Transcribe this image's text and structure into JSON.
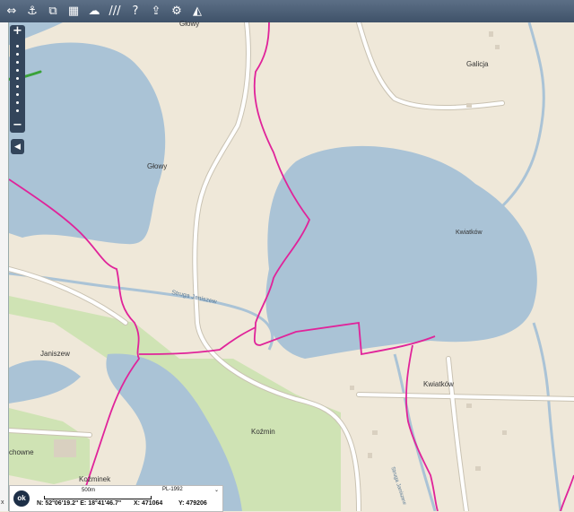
{
  "toolbar": {
    "icons": [
      "pan-icon",
      "anchor-icon",
      "layers-export-icon",
      "layout-icon",
      "bubble-icon",
      "hatch-icon",
      "help-icon",
      "cloud-icon",
      "settings-icon",
      "measure-icon"
    ],
    "glyphs": [
      "⇔",
      "⚓",
      "⧉",
      "▦",
      "☁",
      "///",
      "?",
      "⇪",
      "⚙",
      "◭"
    ]
  },
  "map": {
    "labels": {
      "glowy_top": "Głowy",
      "glowy_lake": "Głowy",
      "galicja": "Galicja",
      "kwiatkow_lake": "Kwiatków",
      "kwiatkow_village": "Kwiatków",
      "strugajaniszew": "Struga Janiszew",
      "janiszew": "Janiszew",
      "kozmin": "Koźmin",
      "kozminek": "Koźminek",
      "chowne": "chowne",
      "struga_janiszew_vertical": "Struga Janiszew"
    },
    "colors": {
      "land": "#efe8d9",
      "water": "#aac3d6",
      "green": "#cfe3b4",
      "road": "#ffffff",
      "road_edge": "#c9c2b2",
      "boundary": "#e0239a",
      "track": "#3aa23a"
    }
  },
  "zoom": {
    "plus": "+",
    "minus": "−",
    "collapse": "◀"
  },
  "status": {
    "ok": "ok",
    "scale_label": "500m",
    "projection": "PL-1992",
    "coords": "N: 52°06'19.2\" E: 18°41'46.7\"",
    "x_value": "X: 471064",
    "y_value": "Y: 479206",
    "left_edge": "x"
  }
}
